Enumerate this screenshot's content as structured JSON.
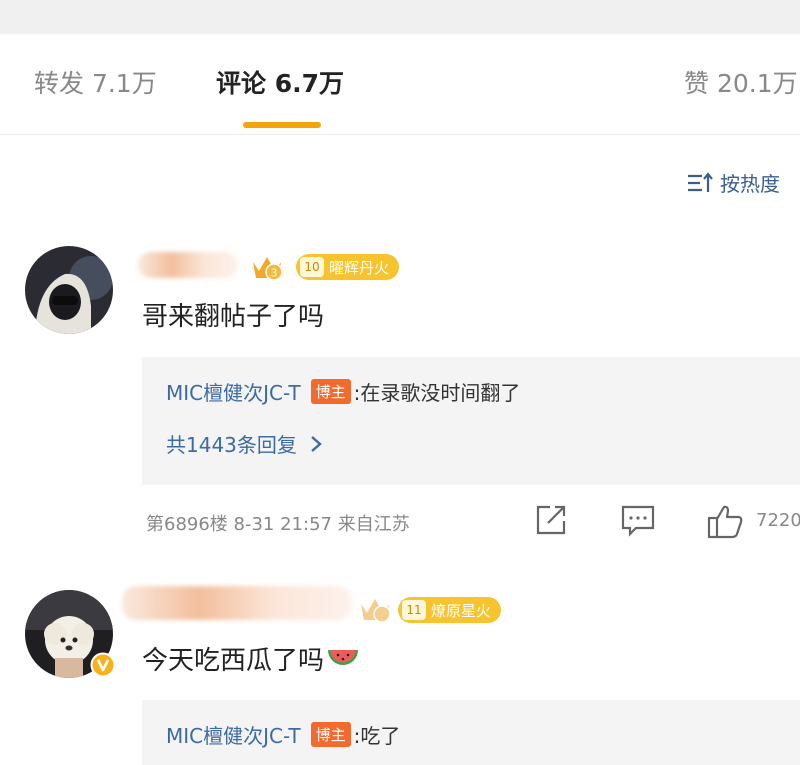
{
  "tabs": {
    "repost": "转发 7.1万",
    "comments": "评论 6.7万",
    "likes": "赞 20.1万"
  },
  "sort": {
    "label": "按热度",
    "icon": "sort-icon"
  },
  "comments": [
    {
      "fan_badge": {
        "level": "10",
        "label": "曜辉丹火"
      },
      "text": "哥来翻帖子了吗",
      "reply": {
        "author": "MIC檀健次JC-T",
        "badge": "博主",
        "text": ":在录歌没时间翻了"
      },
      "more_replies": "共1443条回复",
      "meta": "第6896楼 8-31 21:57 来自江苏",
      "likes": "7220"
    },
    {
      "fan_badge": {
        "level": "11",
        "label": "燎原星火"
      },
      "text": "今天吃西瓜了吗",
      "emoji": "watermelon-emoji",
      "reply": {
        "author": "MIC檀健次JC-T",
        "badge": "博主",
        "text": ":吃了"
      }
    }
  ],
  "colors": {
    "accent": "#f2a40c",
    "link": "#3c6aa3",
    "host_badge": "#f26a2e",
    "fan_badge": "#f7c42f"
  }
}
